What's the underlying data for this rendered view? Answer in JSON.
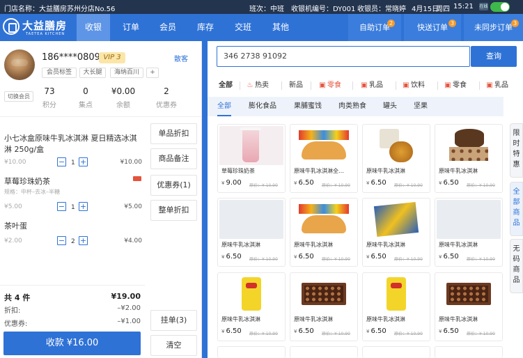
{
  "topbar": {
    "store_label": "门店名称：大益膳房苏州分店No.56",
    "shift_label": "班次：中班",
    "register_label": "收银机编号：DY001",
    "cashier_label": "收银员：常晓婷",
    "date": "4月15日",
    "weekday": "周四",
    "time": "15:21",
    "online_badge": "在线"
  },
  "nav": {
    "logo_name": "大益膳房",
    "logo_sub": "TAETEA KITCHEN",
    "tabs": [
      "收银",
      "订单",
      "会员",
      "库存",
      "交班",
      "其他"
    ],
    "active_tab": "收银",
    "right_tabs": [
      {
        "label": "自助订单",
        "count": "2"
      },
      {
        "label": "快送订单",
        "count": "3"
      },
      {
        "label": "未同步订单",
        "count": "3"
      }
    ]
  },
  "member": {
    "phone": "186****0809",
    "vip": "VIP 3",
    "scatter_label": "散客",
    "tags": [
      "会员标签",
      "大长腿",
      "海纳百川",
      "+"
    ],
    "switch_label": "切换会员",
    "stats": [
      {
        "value": "73",
        "label": "积分"
      },
      {
        "value": "0",
        "label": "集点"
      },
      {
        "value": "¥0.00",
        "label": "余额"
      },
      {
        "value": "2",
        "label": "优惠券"
      }
    ]
  },
  "cart": {
    "items": [
      {
        "name": "小七冰盒原味牛乳冰淇淋 夏日精选冰淇淋 250g/盒",
        "spec": "",
        "price": "¥10.00",
        "qty": "1",
        "total": "¥10.00"
      },
      {
        "name": "草莓珍珠奶茶",
        "spec": "规格：中杯–去冰–半糖",
        "price": "¥5.00",
        "qty": "1",
        "total": "¥5.00"
      },
      {
        "name": "茶叶蛋",
        "spec": "",
        "price": "¥2.00",
        "qty": "2",
        "total": "¥4.00"
      }
    ],
    "actions": [
      "单品折扣",
      "商品备注",
      "优惠券(1)",
      "整单折扣"
    ],
    "hang_label": "挂单(3)",
    "clear_label": "清空",
    "summary": {
      "count_label": "共 4 件",
      "subtotal": "¥19.00",
      "discount_label": "折扣:",
      "discount": "–¥2.00",
      "coupon_label": "优惠券:",
      "coupon": "–¥1.00"
    },
    "pay_label": "收款 ¥16.00"
  },
  "search": {
    "value": "346 2738 91092",
    "button": "查询"
  },
  "categories": {
    "level1": [
      "全部",
      "热卖",
      "新品",
      "零食",
      "乳品",
      "饮料",
      "零食",
      "乳品"
    ],
    "level1_active": "零食",
    "level2": [
      "全部",
      "膨化食品",
      "果脯蜜饯",
      "肉类熟食",
      "罐头",
      "坚果"
    ],
    "level2_active": "全部",
    "side": [
      "限时特惠",
      "全部商品",
      "无码商品"
    ]
  },
  "products": [
    {
      "name": "草莓珍珠奶茶",
      "price": "9.00",
      "old": "原价：¥ 10.90",
      "img": "drink"
    },
    {
      "name": "原味牛乳冰淇淋全…",
      "price": "6.50",
      "old": "原价：¥ 10.90",
      "img": "snack"
    },
    {
      "name": "原味牛乳冰淇淋",
      "price": "6.50",
      "old": "原价：¥ 10.90",
      "img": "chestnut"
    },
    {
      "name": "原味牛乳冰淇淋",
      "price": "6.50",
      "old": "原价：¥ 10.90",
      "img": "tin"
    },
    {
      "name": "原味牛乳冰淇淋",
      "price": "6.50",
      "old": "原价：¥ 10.90",
      "img": "blank"
    },
    {
      "name": "原味牛乳冰淇淋",
      "price": "6.50",
      "old": "原价：¥ 10.90",
      "img": "snack"
    },
    {
      "name": "原味牛乳冰淇淋",
      "price": "6.50",
      "old": "原价：¥ 10.90",
      "img": "box"
    },
    {
      "name": "原味牛乳冰淇淋",
      "price": "6.50",
      "old": "原价：¥ 10.90",
      "img": "blank"
    },
    {
      "name": "原味牛乳冰淇淋",
      "price": "6.50",
      "old": "原价：¥ 10.90",
      "img": "chips"
    },
    {
      "name": "原味牛乳冰淇淋",
      "price": "6.50",
      "old": "原价：¥ 10.90",
      "img": "choco"
    },
    {
      "name": "原味牛乳冰淇淋",
      "price": "6.50",
      "old": "原价：¥ 10.90",
      "img": "chips"
    },
    {
      "name": "原味牛乳冰淇淋",
      "price": "6.50",
      "old": "原价：¥ 10.90",
      "img": "choco"
    }
  ],
  "currency_symbol": "¥",
  "colors": {
    "primary": "#2f72d6",
    "topbar": "#23344f",
    "accent_red": "#e5533d",
    "badge_orange": "#f39a2b"
  }
}
